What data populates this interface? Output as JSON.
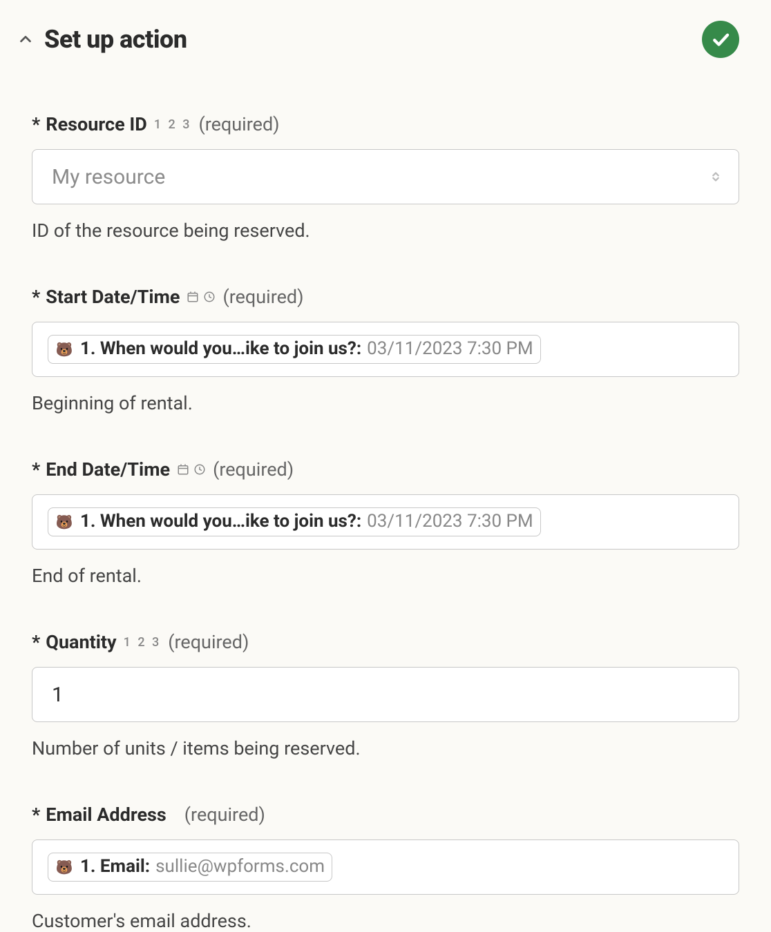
{
  "header": {
    "title": "Set up action",
    "status": "complete"
  },
  "requiredText": "(required)",
  "fields": {
    "resource": {
      "label": "Resource ID",
      "typeHint": "number",
      "placeholder": "My resource",
      "help": "ID of the resource being reserved."
    },
    "start": {
      "label": "Start Date/Time",
      "typeHint": "datetime",
      "pillLabel": "1. When would you…ike to join us?:",
      "pillValue": "03/11/2023 7:30 PM",
      "help": "Beginning of rental."
    },
    "end": {
      "label": "End Date/Time",
      "typeHint": "datetime",
      "pillLabel": "1. When would you…ike to join us?:",
      "pillValue": "03/11/2023 7:30 PM",
      "help": "End of rental."
    },
    "quantity": {
      "label": "Quantity",
      "typeHint": "number",
      "value": "1",
      "help": "Number of units / items being reserved."
    },
    "email": {
      "label": "Email Address",
      "typeHint": "none",
      "pillLabel": "1. Email:",
      "pillValue": "sullie@wpforms.com",
      "help": "Customer's email address."
    }
  },
  "icons": {
    "logo": "🐻"
  }
}
